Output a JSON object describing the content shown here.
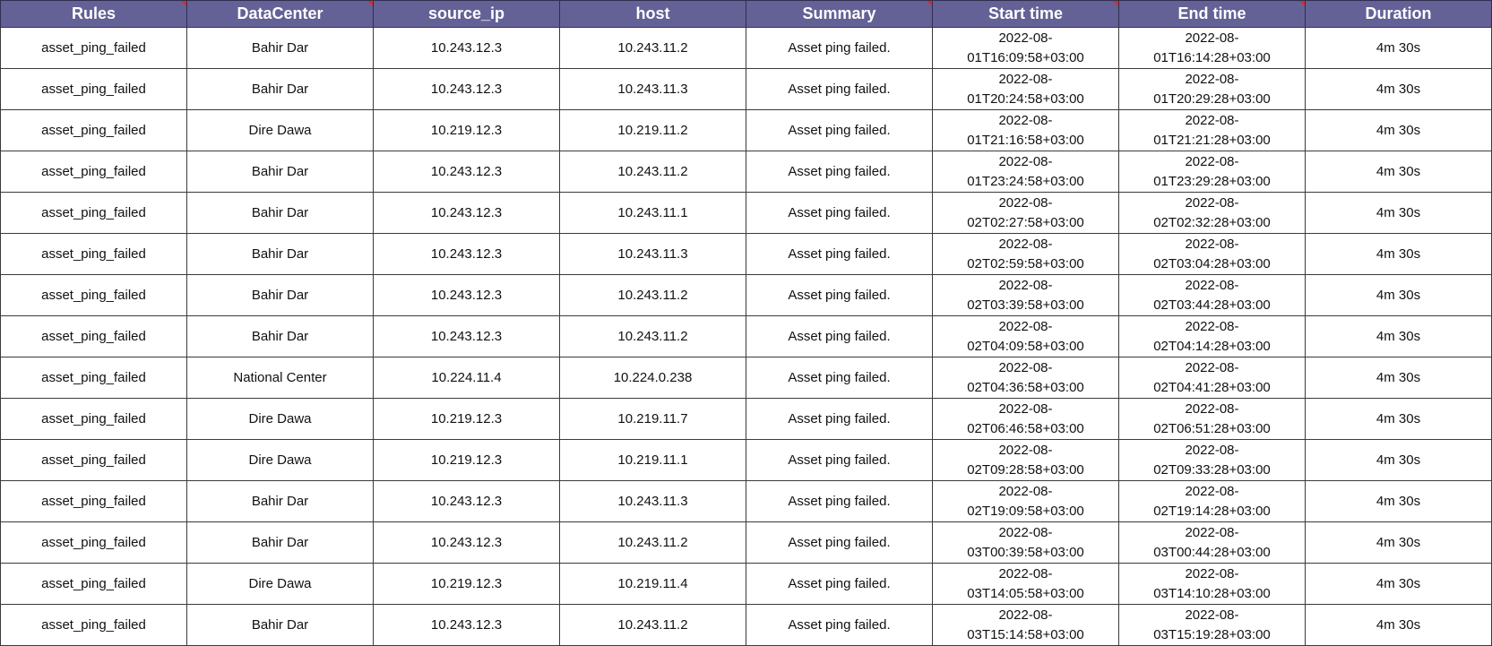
{
  "sheet": {
    "headers": [
      "Rules",
      "DataCenter",
      "source_ip",
      "host",
      "Summary",
      "Start time",
      "End time",
      "Duration"
    ],
    "header_comment_columns": [
      0,
      1,
      4,
      5,
      6
    ],
    "colors": {
      "header_background": "#636196",
      "header_text": "#ffffff",
      "comment_indicator": "#d0302a",
      "grid_line": "#3a3a3a"
    },
    "rows": [
      {
        "rule": "asset_ping_failed",
        "datacenter": "Bahir Dar",
        "source_ip": "10.243.12.3",
        "host": "10.243.11.2",
        "summary": "Asset ping failed.",
        "start_line1": "2022-08-",
        "start_line2": "01T16:09:58+03:00",
        "end_line1": "2022-08-",
        "end_line2": "01T16:14:28+03:00",
        "duration": "4m 30s"
      },
      {
        "rule": "asset_ping_failed",
        "datacenter": "Bahir Dar",
        "source_ip": "10.243.12.3",
        "host": "10.243.11.3",
        "summary": "Asset ping failed.",
        "start_line1": "2022-08-",
        "start_line2": "01T20:24:58+03:00",
        "end_line1": "2022-08-",
        "end_line2": "01T20:29:28+03:00",
        "duration": "4m 30s"
      },
      {
        "rule": "asset_ping_failed",
        "datacenter": "Dire Dawa",
        "source_ip": "10.219.12.3",
        "host": "10.219.11.2",
        "summary": "Asset ping failed.",
        "start_line1": "2022-08-",
        "start_line2": "01T21:16:58+03:00",
        "end_line1": "2022-08-",
        "end_line2": "01T21:21:28+03:00",
        "duration": "4m 30s"
      },
      {
        "rule": "asset_ping_failed",
        "datacenter": "Bahir Dar",
        "source_ip": "10.243.12.3",
        "host": "10.243.11.2",
        "summary": "Asset ping failed.",
        "start_line1": "2022-08-",
        "start_line2": "01T23:24:58+03:00",
        "end_line1": "2022-08-",
        "end_line2": "01T23:29:28+03:00",
        "duration": "4m 30s"
      },
      {
        "rule": "asset_ping_failed",
        "datacenter": "Bahir Dar",
        "source_ip": "10.243.12.3",
        "host": "10.243.11.1",
        "summary": "Asset ping failed.",
        "start_line1": "2022-08-",
        "start_line2": "02T02:27:58+03:00",
        "end_line1": "2022-08-",
        "end_line2": "02T02:32:28+03:00",
        "duration": "4m 30s"
      },
      {
        "rule": "asset_ping_failed",
        "datacenter": "Bahir Dar",
        "source_ip": "10.243.12.3",
        "host": "10.243.11.3",
        "summary": "Asset ping failed.",
        "start_line1": "2022-08-",
        "start_line2": "02T02:59:58+03:00",
        "end_line1": "2022-08-",
        "end_line2": "02T03:04:28+03:00",
        "duration": "4m 30s"
      },
      {
        "rule": "asset_ping_failed",
        "datacenter": "Bahir Dar",
        "source_ip": "10.243.12.3",
        "host": "10.243.11.2",
        "summary": "Asset ping failed.",
        "start_line1": "2022-08-",
        "start_line2": "02T03:39:58+03:00",
        "end_line1": "2022-08-",
        "end_line2": "02T03:44:28+03:00",
        "duration": "4m 30s"
      },
      {
        "rule": "asset_ping_failed",
        "datacenter": "Bahir Dar",
        "source_ip": "10.243.12.3",
        "host": "10.243.11.2",
        "summary": "Asset ping failed.",
        "start_line1": "2022-08-",
        "start_line2": "02T04:09:58+03:00",
        "end_line1": "2022-08-",
        "end_line2": "02T04:14:28+03:00",
        "duration": "4m 30s"
      },
      {
        "rule": "asset_ping_failed",
        "datacenter": "National Center",
        "source_ip": "10.224.11.4",
        "host": "10.224.0.238",
        "summary": "Asset ping failed.",
        "start_line1": "2022-08-",
        "start_line2": "02T04:36:58+03:00",
        "end_line1": "2022-08-",
        "end_line2": "02T04:41:28+03:00",
        "duration": "4m 30s"
      },
      {
        "rule": "asset_ping_failed",
        "datacenter": "Dire Dawa",
        "source_ip": "10.219.12.3",
        "host": "10.219.11.7",
        "summary": "Asset ping failed.",
        "start_line1": "2022-08-",
        "start_line2": "02T06:46:58+03:00",
        "end_line1": "2022-08-",
        "end_line2": "02T06:51:28+03:00",
        "duration": "4m 30s"
      },
      {
        "rule": "asset_ping_failed",
        "datacenter": "Dire Dawa",
        "source_ip": "10.219.12.3",
        "host": "10.219.11.1",
        "summary": "Asset ping failed.",
        "start_line1": "2022-08-",
        "start_line2": "02T09:28:58+03:00",
        "end_line1": "2022-08-",
        "end_line2": "02T09:33:28+03:00",
        "duration": "4m 30s"
      },
      {
        "rule": "asset_ping_failed",
        "datacenter": "Bahir Dar",
        "source_ip": "10.243.12.3",
        "host": "10.243.11.3",
        "summary": "Asset ping failed.",
        "start_line1": "2022-08-",
        "start_line2": "02T19:09:58+03:00",
        "end_line1": "2022-08-",
        "end_line2": "02T19:14:28+03:00",
        "duration": "4m 30s"
      },
      {
        "rule": "asset_ping_failed",
        "datacenter": "Bahir Dar",
        "source_ip": "10.243.12.3",
        "host": "10.243.11.2",
        "summary": "Asset ping failed.",
        "start_line1": "2022-08-",
        "start_line2": "03T00:39:58+03:00",
        "end_line1": "2022-08-",
        "end_line2": "03T00:44:28+03:00",
        "duration": "4m 30s"
      },
      {
        "rule": "asset_ping_failed",
        "datacenter": "Dire Dawa",
        "source_ip": "10.219.12.3",
        "host": "10.219.11.4",
        "summary": "Asset ping failed.",
        "start_line1": "2022-08-",
        "start_line2": "03T14:05:58+03:00",
        "end_line1": "2022-08-",
        "end_line2": "03T14:10:28+03:00",
        "duration": "4m 30s"
      },
      {
        "rule": "asset_ping_failed",
        "datacenter": "Bahir Dar",
        "source_ip": "10.243.12.3",
        "host": "10.243.11.2",
        "summary": "Asset ping failed.",
        "start_line1": "2022-08-",
        "start_line2": "03T15:14:58+03:00",
        "end_line1": "2022-08-",
        "end_line2": "03T15:19:28+03:00",
        "duration": "4m 30s"
      }
    ]
  }
}
